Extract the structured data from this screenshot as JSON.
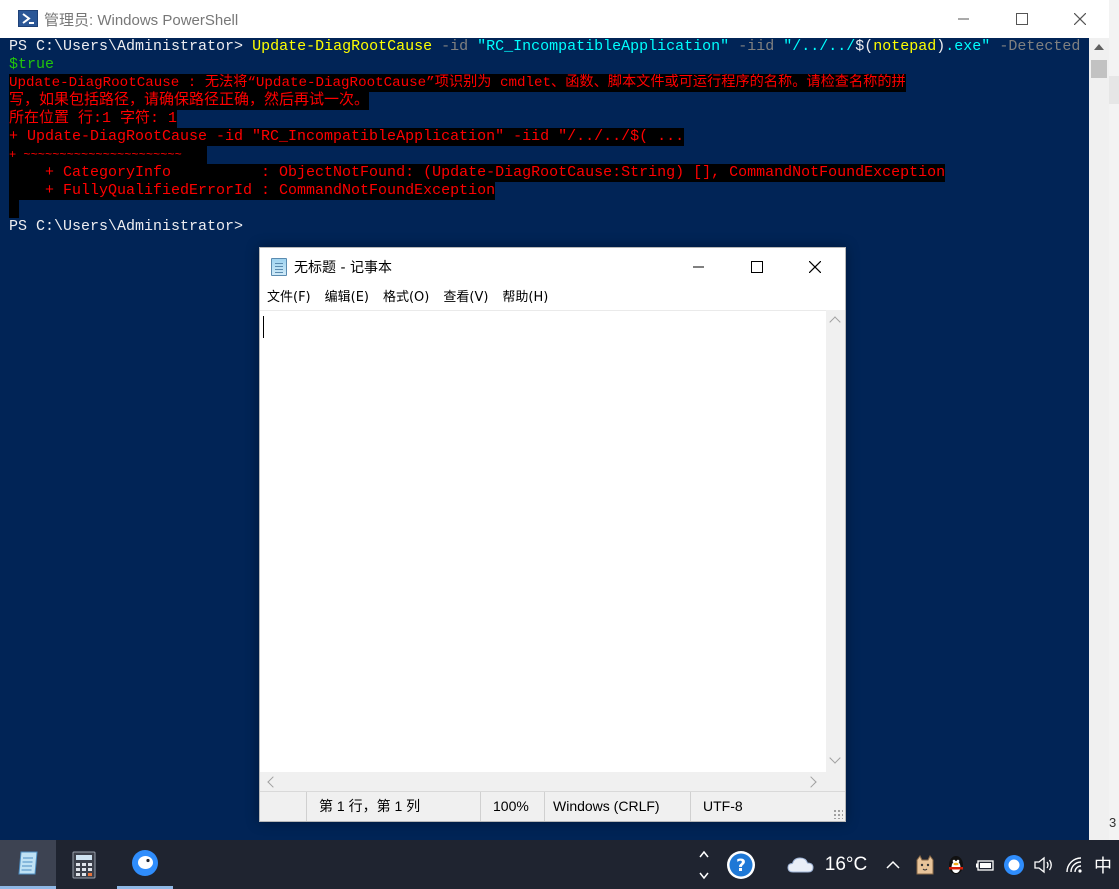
{
  "powershell": {
    "title": "管理员: Windows PowerShell",
    "prompt": "PS C:\\Users\\Administrator>",
    "command": {
      "cmdlet": "Update-DiagRootCause",
      "p_id": "-id",
      "v_id": "\"RC_IncompatibleApplication\"",
      "p_iid": "-iid",
      "v_iid_a": "\"/../../",
      "dollar": "$(",
      "notepad": "notepad",
      "close_paren": ")",
      "v_iid_b": ".exe\"",
      "p_detected": "-Detected",
      "v_true": "$true"
    },
    "error_lines": [
      "Update-DiagRootCause : 无法将“Update-DiagRootCause”项识别为 cmdlet、函数、脚本文件或可运行程序的名称。请检查名称的拼",
      "写，如果包括路径，请确保路径正确，然后再试一次。",
      "所在位置 行:1 字符: 1",
      "+ Update-DiagRootCause -id \"RC_IncompatibleApplication\" -iid \"/../../$( ...",
      "+ ~~~~~~~~~~~~~~~~~~~~~~",
      "    + CategoryInfo          : ObjectNotFound: (Update-DiagRootCause:String) [], CommandNotFoundException",
      "    + FullyQualifiedErrorId : CommandNotFoundException"
    ],
    "prompt2": "PS C:\\Users\\Administrator>"
  },
  "notepad": {
    "title": "无标题 - 记事本",
    "menu": [
      "文件(F)",
      "编辑(E)",
      "格式(O)",
      "查看(V)",
      "帮助(H)"
    ],
    "status": {
      "position": "第 1 行，第 1 列",
      "zoom": "100%",
      "line_ending": "Windows (CRLF)",
      "encoding": "UTF-8"
    }
  },
  "background": {
    "right_edge_number": "3"
  },
  "taskbar": {
    "temperature": "16°C",
    "ime": "中"
  }
}
